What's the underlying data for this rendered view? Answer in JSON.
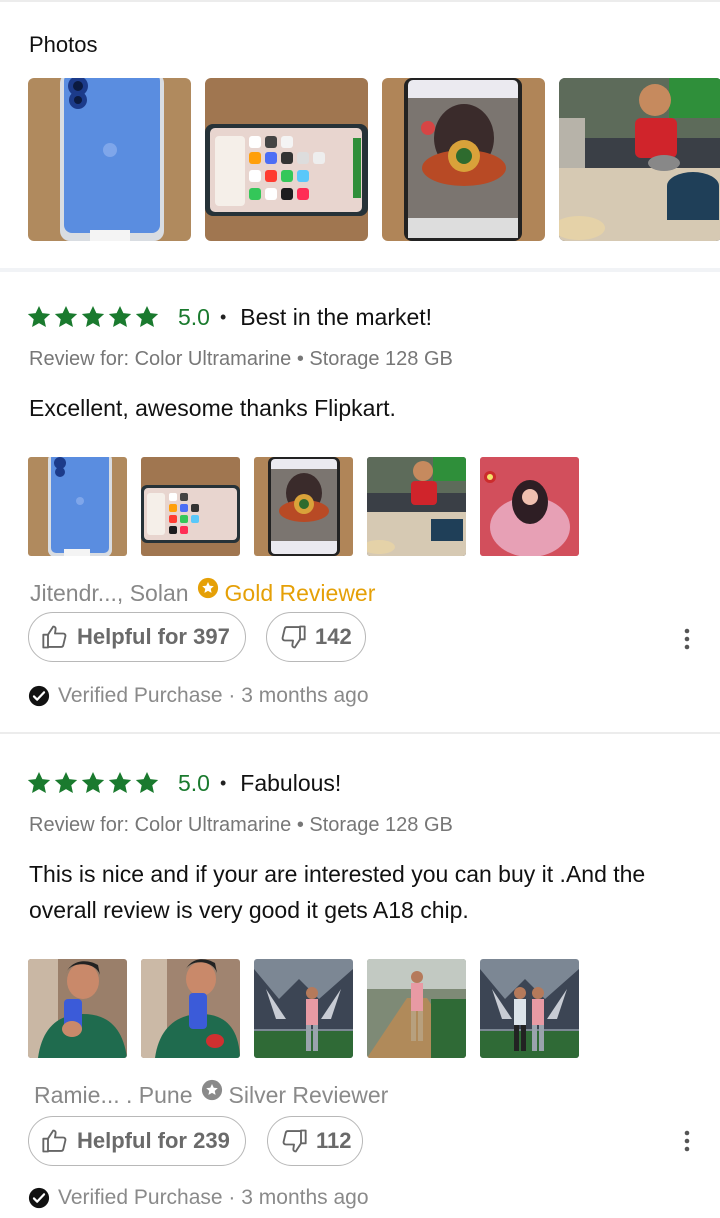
{
  "photos": {
    "title": "Photos"
  },
  "reviews": [
    {
      "score": "5.0",
      "separator": "•",
      "title": "Best in the market!",
      "review_for": "Review for: Color Ultramarine • Storage 128 GB",
      "body": "Excellent, awesome thanks  Flipkart.",
      "author": "Jitendr..., Solan",
      "badge": "Gold Reviewer",
      "helpful_label": "Helpful for 397",
      "dislikes": "142",
      "verified": "Verified Purchase · 3 months ago"
    },
    {
      "score": "5.0",
      "separator": "•",
      "title": "Fabulous!",
      "review_for": "Review for: Color Ultramarine • Storage 128 GB",
      "body": "This is nice and if your are interested you can buy it .And the overall review is very good it gets A18 chip.",
      "author": "Ramie... . Pune",
      "badge": "Silver Reviewer",
      "helpful_label": "Helpful for 239",
      "dislikes": "112",
      "verified": "Verified Purchase · 3 months ago"
    }
  ],
  "icons": {
    "star": "star-icon",
    "gold_badge": "star-badge-icon",
    "silver_badge": "star-badge-icon",
    "thumbs_up": "thumbs-up-icon",
    "thumbs_down": "thumbs-down-icon",
    "more": "more-vertical-icon",
    "verified": "check-circle-icon"
  },
  "colors": {
    "rating_green": "#1a7a2e",
    "gold": "#e5a007",
    "silver": "#8a8a8a",
    "muted_text": "#777777"
  }
}
